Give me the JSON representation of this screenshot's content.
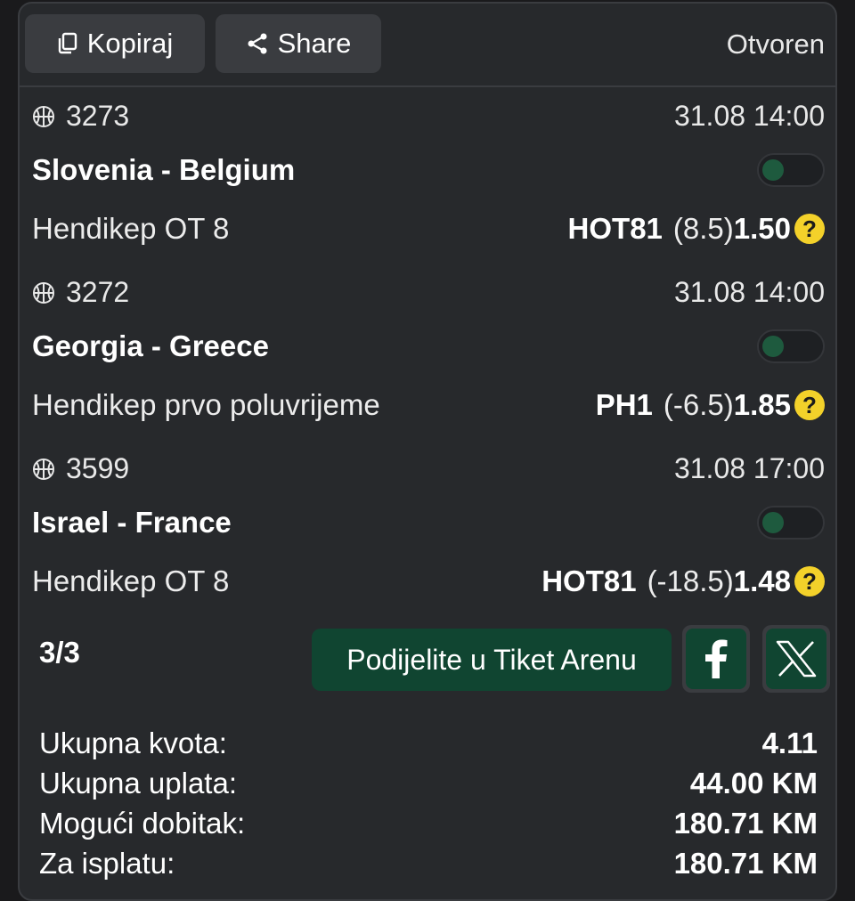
{
  "toolbar": {
    "copy_label": "Kopiraj",
    "share_label": "Share",
    "status": "Otvoren"
  },
  "matches": [
    {
      "code": "3273",
      "datetime": "31.08 14:00",
      "teams": "Slovenia - Belgium",
      "market": "Hendikep OT 8",
      "tip": "HOT81",
      "line": "(8.5)",
      "odd": "1.50",
      "help": "?",
      "sport_icon": "basketball-icon",
      "toggle_on": false
    },
    {
      "code": "3272",
      "datetime": "31.08 14:00",
      "teams": "Georgia - Greece",
      "market": "Hendikep prvo poluvrijeme",
      "tip": "PH1",
      "line": "(-6.5)",
      "odd": "1.85",
      "help": "?",
      "sport_icon": "basketball-icon",
      "toggle_on": false
    },
    {
      "code": "3599",
      "datetime": "31.08 17:00",
      "teams": "Israel - France",
      "market": "Hendikep OT 8",
      "tip": "HOT81",
      "line": "(-18.5)",
      "odd": "1.48",
      "help": "?",
      "sport_icon": "basketball-icon",
      "toggle_on": false
    }
  ],
  "footer": {
    "count": "3/3",
    "arena_label": "Podijelite u Tiket Arenu",
    "facebook_icon": "facebook-icon",
    "x_icon": "x-icon"
  },
  "summary": [
    {
      "label": "Ukupna kvota:",
      "value": "4.11"
    },
    {
      "label": "Ukupna uplata:",
      "value": "44.00 KM"
    },
    {
      "label": "Mogući dobitak:",
      "value": "180.71 KM"
    },
    {
      "label": "Za isplatu:",
      "value": "180.71 KM"
    }
  ],
  "colors": {
    "background": "#1a1a1c",
    "card": "#27292c",
    "accent_green": "#104531",
    "help_yellow": "#f3d12a"
  }
}
